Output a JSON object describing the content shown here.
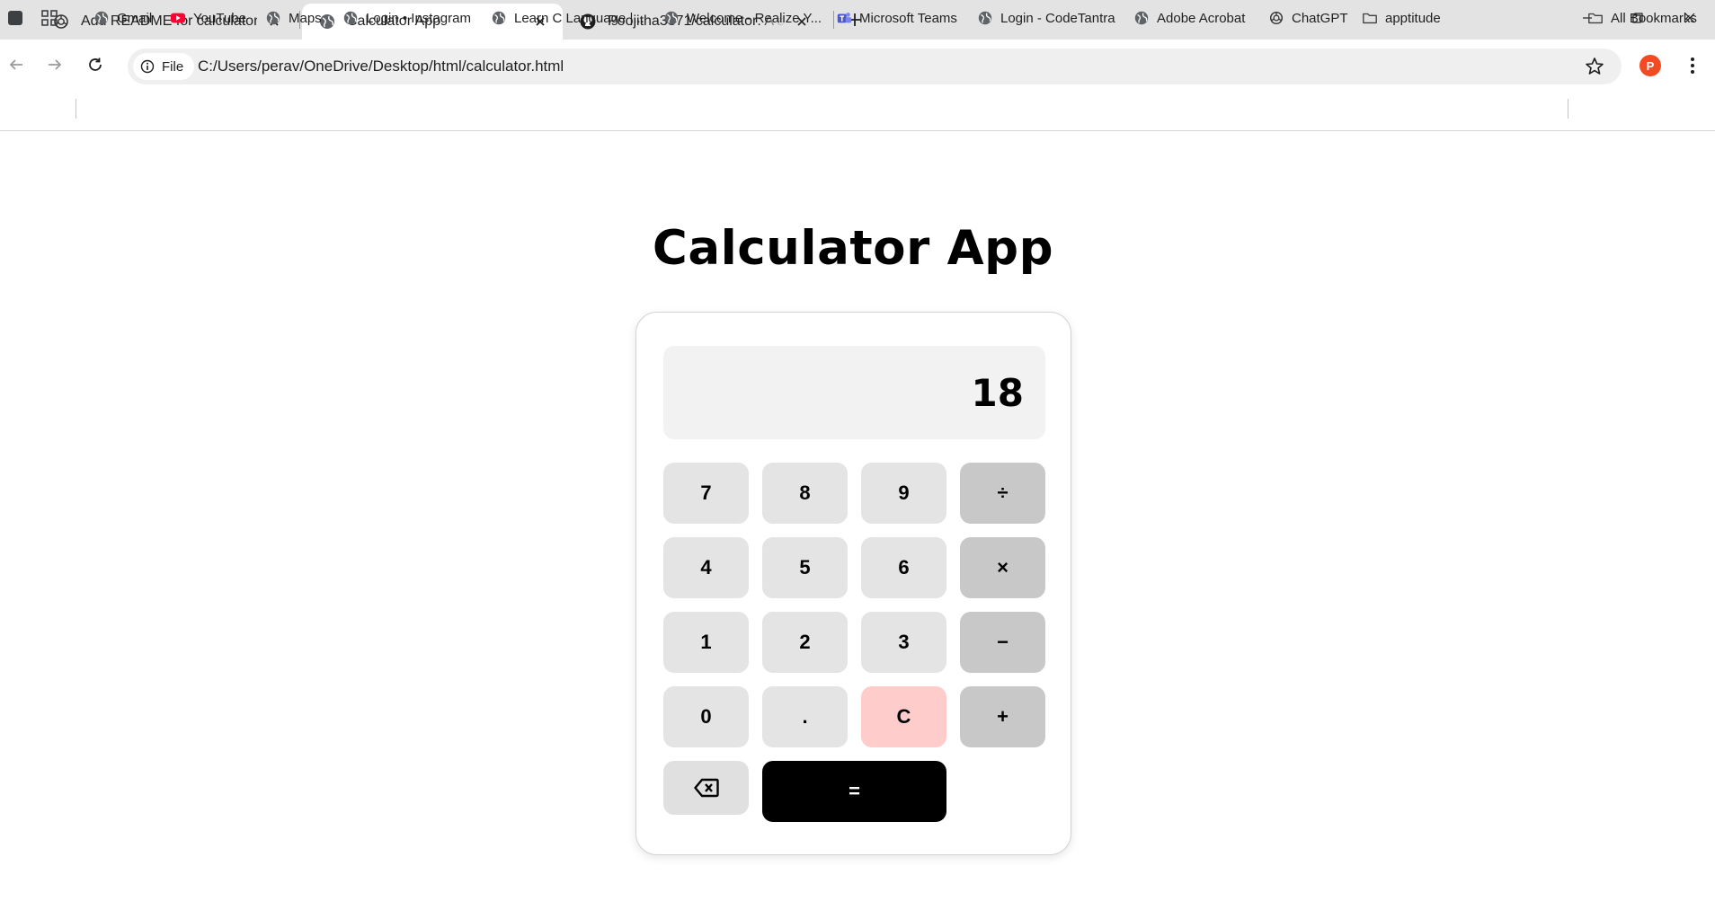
{
  "browser": {
    "tabs": [
      {
        "label": "Add README for calculator",
        "icon": "chatgpt-icon",
        "active": false
      },
      {
        "label": "Calculator App",
        "icon": "globe-icon",
        "active": true
      },
      {
        "label": "Poojitha3371/calculator: A simp",
        "icon": "github-icon",
        "active": false
      }
    ],
    "address": {
      "chip": "File",
      "url": "C:/Users/perav/OneDrive/Desktop/html/calculator.html"
    },
    "profile_initial": "P",
    "bookmarks": [
      {
        "label": "Gmail",
        "icon": "globe-icon"
      },
      {
        "label": "YouTube",
        "icon": "youtube-icon"
      },
      {
        "label": "Maps",
        "icon": "globe-icon"
      },
      {
        "label": "Login • Instagram",
        "icon": "globe-icon"
      },
      {
        "label": "Learn C Language |...",
        "icon": "globe-icon"
      },
      {
        "label": "Welcome - Realize Y...",
        "icon": "globe-icon"
      },
      {
        "label": "Microsoft Teams",
        "icon": "teams-icon"
      },
      {
        "label": "Login - CodeTantra",
        "icon": "globe-icon"
      },
      {
        "label": "Adobe Acrobat",
        "icon": "globe-icon"
      },
      {
        "label": "ChatGPT",
        "icon": "chatgpt-icon"
      },
      {
        "label": "apptitude",
        "icon": "folder-icon"
      }
    ],
    "all_bookmarks": "All Bookmarks"
  },
  "page": {
    "title": "Calculator App",
    "display": "18",
    "keys": {
      "k7": "7",
      "k8": "8",
      "k9": "9",
      "divide": "÷",
      "k4": "4",
      "k5": "5",
      "k6": "6",
      "multiply": "×",
      "k1": "1",
      "k2": "2",
      "k3": "3",
      "subtract": "−",
      "k0": "0",
      "dot": ".",
      "clear": "C",
      "add": "+",
      "equals": "="
    }
  },
  "colors": {
    "tabstrip": "#e3e3e3",
    "key": "#e4e4e4",
    "operator_key": "#c8c8c8",
    "clear_key": "#ffcccc",
    "equals_key": "#000000",
    "profile": "#f04b23"
  }
}
